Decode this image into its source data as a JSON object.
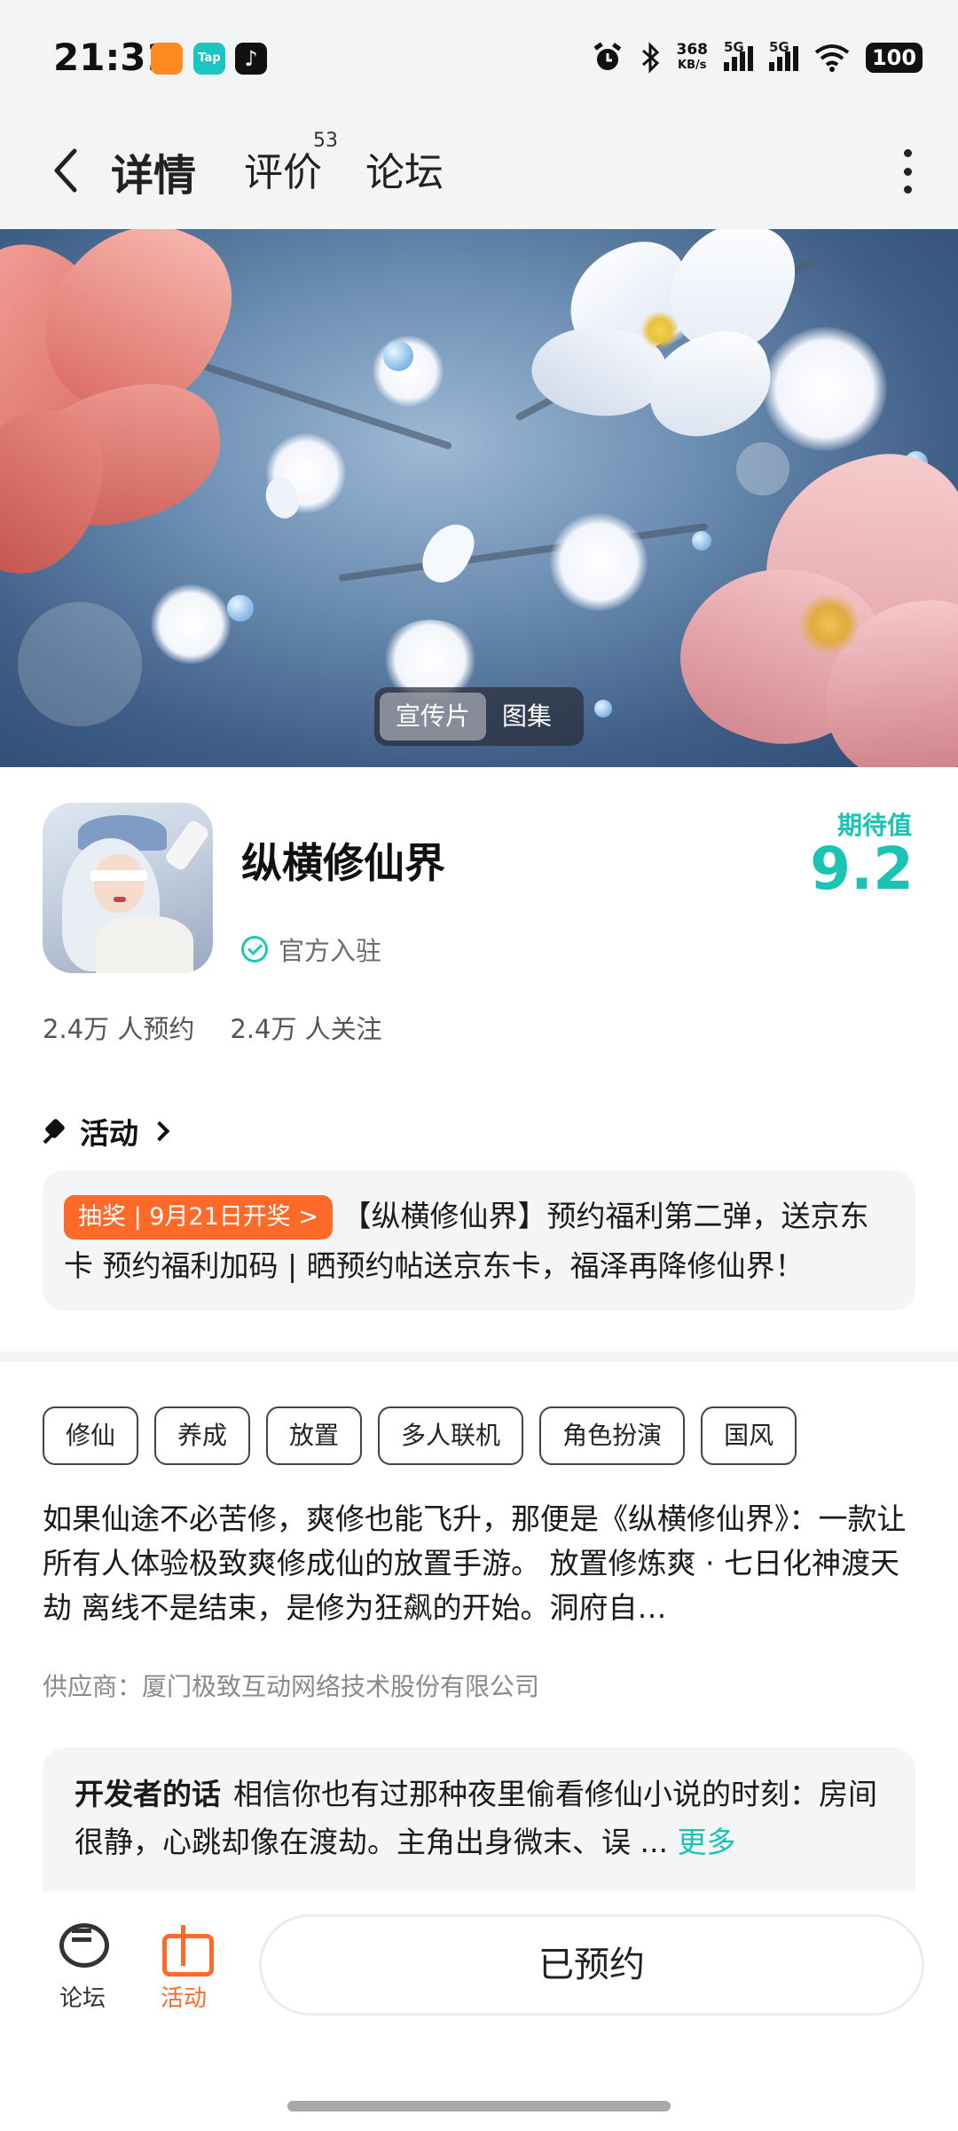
{
  "status_bar": {
    "time": "21:31",
    "net_speed_value": "368",
    "net_speed_unit": "KB/s",
    "sim1": "5G",
    "sim2": "5G",
    "battery": "100",
    "app_icons": [
      "taobao-app-icon",
      "taptap-app-icon",
      "tiktok-app-icon"
    ],
    "app_icon_labels": {
      "taptap": "Tap"
    }
  },
  "nav": {
    "tabs": [
      {
        "label": "详情",
        "active": true
      },
      {
        "label": "评价",
        "badge": "53"
      },
      {
        "label": "论坛"
      }
    ]
  },
  "banner": {
    "switch": [
      "宣传片",
      "图集"
    ]
  },
  "game": {
    "title": "纵横修仙界",
    "official_label": "官方入驻",
    "expect_label": "期待值",
    "expect_value": "9.2",
    "reservations": "2.4万 人预约",
    "followers": "2.4万 人关注"
  },
  "activity": {
    "heading": "活动",
    "badge": "抽奖 | 9月21日开奖 >",
    "text": "【纵横修仙界】预约福利第二弹，送京东卡 预约福利加码 | 晒预约帖送京东卡，福泽再降修仙界！"
  },
  "tags": [
    "修仙",
    "养成",
    "放置",
    "多人联机",
    "角色扮演",
    "国风"
  ],
  "description": "如果仙途不必苦修，爽修也能飞升，那便是《纵横修仙界》：一款让所有人体验极致爽修成仙的放置手游。 放置修炼爽 · 七日化神渡天劫 离线不是结束，是修为狂飙的开始。洞府自…",
  "supplier": "供应商：厦门极致互动网络技术股份有限公司",
  "developer": {
    "title": "开发者的话",
    "text": "相信你也有过那种夜里偷看修仙小说的时刻：房间很静，心跳却像在渡劫。主角出身微末、误 ...",
    "more": "更多"
  },
  "bottom_bar": {
    "forum": "论坛",
    "activity": "活动",
    "reserve_button": "已预约"
  },
  "colors": {
    "accent": "#19c4b4",
    "orange": "#ff6a2a",
    "background": "#f3f4f5"
  }
}
